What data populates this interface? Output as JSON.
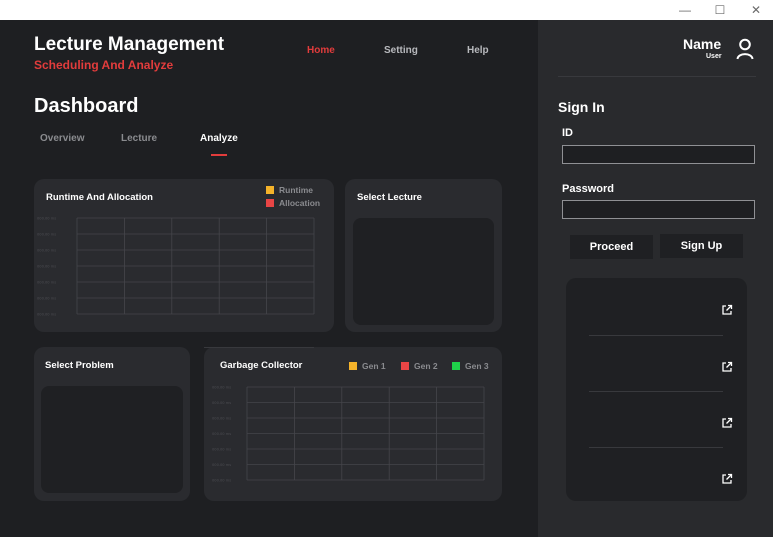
{
  "window": {
    "minimize_glyph": "—",
    "maximize_glyph": "☐",
    "close_glyph": "✕"
  },
  "header": {
    "title": "Lecture Management",
    "subtitle": "Scheduling And Analyze"
  },
  "nav": [
    {
      "label": "Home",
      "active": true
    },
    {
      "label": "Setting",
      "active": false
    },
    {
      "label": "Help",
      "active": false
    }
  ],
  "page": {
    "title": "Dashboard"
  },
  "tabs": [
    {
      "label": "Overview",
      "active": false
    },
    {
      "label": "Lecture",
      "active": false
    },
    {
      "label": "Analyze",
      "active": true
    }
  ],
  "runtime_card": {
    "title": "Runtime And Allocation",
    "legend": [
      {
        "label": "Runtime",
        "color": "#f5b32a"
      },
      {
        "label": "Allocation",
        "color": "#e84545"
      }
    ]
  },
  "select_lecture": {
    "title": "Select Lecture"
  },
  "select_problem": {
    "title": "Select Problem"
  },
  "gc_card": {
    "title": "Garbage Collector",
    "legend": [
      {
        "label": "Gen 1",
        "color": "#f5b32a"
      },
      {
        "label": "Gen 2",
        "color": "#e84545"
      },
      {
        "label": "Gen 3",
        "color": "#1fd14a"
      }
    ]
  },
  "chart_data": [
    {
      "type": "line",
      "title": "Runtime And Allocation",
      "series": [
        {
          "name": "Runtime",
          "values": []
        },
        {
          "name": "Allocation",
          "values": []
        }
      ],
      "y_tick_labels": [
        "000.00 ms",
        "000.00 ms",
        "000.00 ms",
        "000.00 ms",
        "000.00 ms",
        "000.00 ms",
        "000.00 ms"
      ],
      "grid": true,
      "legend": "top-right"
    },
    {
      "type": "line",
      "title": "Garbage Collector",
      "series": [
        {
          "name": "Gen 1",
          "values": []
        },
        {
          "name": "Gen 2",
          "values": []
        },
        {
          "name": "Gen 3",
          "values": []
        }
      ],
      "y_tick_labels": [
        "000.00 ms",
        "000.00 ms",
        "000.00 ms",
        "000.00 ms",
        "000.00 ms",
        "000.00 ms",
        "000.00 ms"
      ],
      "grid": true,
      "legend": "top-right"
    }
  ],
  "user": {
    "name": "Name",
    "role": "User",
    "icon": "user-icon"
  },
  "signin": {
    "title": "Sign In",
    "id_label": "ID",
    "id_value": "",
    "password_label": "Password",
    "password_value": "",
    "proceed_label": "Proceed",
    "signup_label": "Sign Up"
  },
  "links": {
    "count_icons": "external-link-icon"
  },
  "colors": {
    "accent": "#e23c3c",
    "background": "#1e1f22",
    "sidebar": "#292a2d",
    "card": "#2a2b2f"
  }
}
